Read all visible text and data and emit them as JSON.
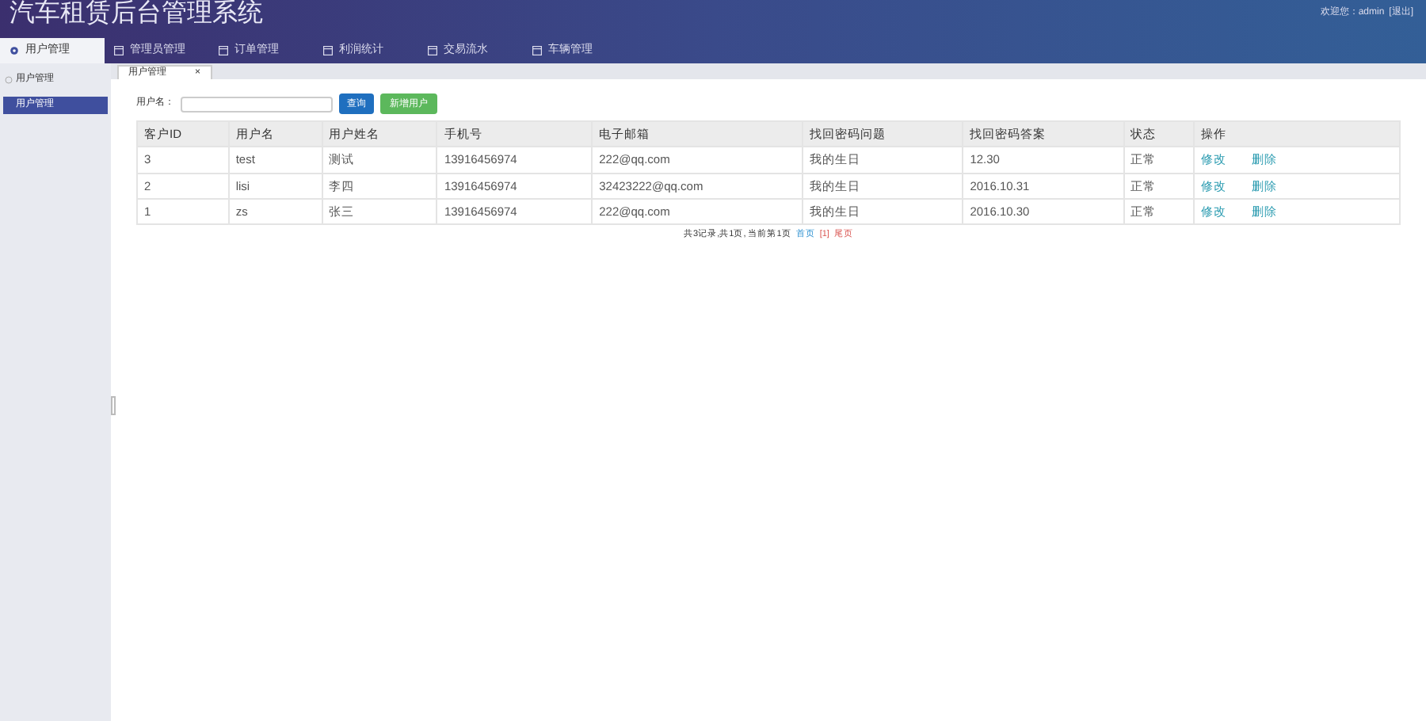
{
  "header": {
    "title": "汽车租赁后台管理系统",
    "welcome": "欢迎您：admin",
    "logout": "[退出]"
  },
  "nav_tabs": [
    {
      "label": "用户管理",
      "selected": true
    },
    {
      "label": "管理员管理",
      "selected": false
    },
    {
      "label": "订单管理",
      "selected": false
    },
    {
      "label": "利润统计",
      "selected": false
    },
    {
      "label": "交易流水",
      "selected": false
    },
    {
      "label": "车辆管理",
      "selected": false
    }
  ],
  "sidebar": {
    "group": {
      "label": "用户管理",
      "expanded": true,
      "children": [
        {
          "label": "用户管理",
          "selected": true
        }
      ]
    }
  },
  "page_tabs": [
    {
      "label": "用户管理",
      "selected": true,
      "close": "×"
    }
  ],
  "search": {
    "label": "用户名：",
    "query_button": "查询",
    "add_button": "新增用户"
  },
  "table": {
    "columns": [
      "客户ID",
      "用户名",
      "用户姓名",
      "手机号",
      "电子邮箱",
      "找回密码问题",
      "找回密码答案",
      "状态",
      "操作"
    ],
    "rows": [
      {
        "cells": [
          "3",
          "test",
          "测试",
          "13916456974",
          "222@qq.com",
          "我的生日",
          "12.30",
          "正常"
        ],
        "actions": [
          "修改",
          "删除"
        ]
      },
      {
        "cells": [
          "2",
          "lisi",
          "李四",
          "13916456974",
          "32423222@qq.com",
          "我的生日",
          "2016.10.31",
          "正常"
        ],
        "actions": [
          "修改",
          "删除"
        ]
      },
      {
        "cells": [
          "1",
          "zs",
          "张三",
          "13916456974",
          "222@qq.com",
          "我的生日",
          "2016.10.30",
          "正常"
        ],
        "actions": [
          "修改",
          "删除"
        ]
      }
    ]
  },
  "pagination": [
    {
      "kind": "text",
      "text": "共3记录,共1页, 当前第1页"
    },
    {
      "kind": "first",
      "text": "首页"
    },
    {
      "kind": "page",
      "text": "[1]"
    },
    {
      "kind": "page",
      "text": "尾页"
    }
  ]
}
